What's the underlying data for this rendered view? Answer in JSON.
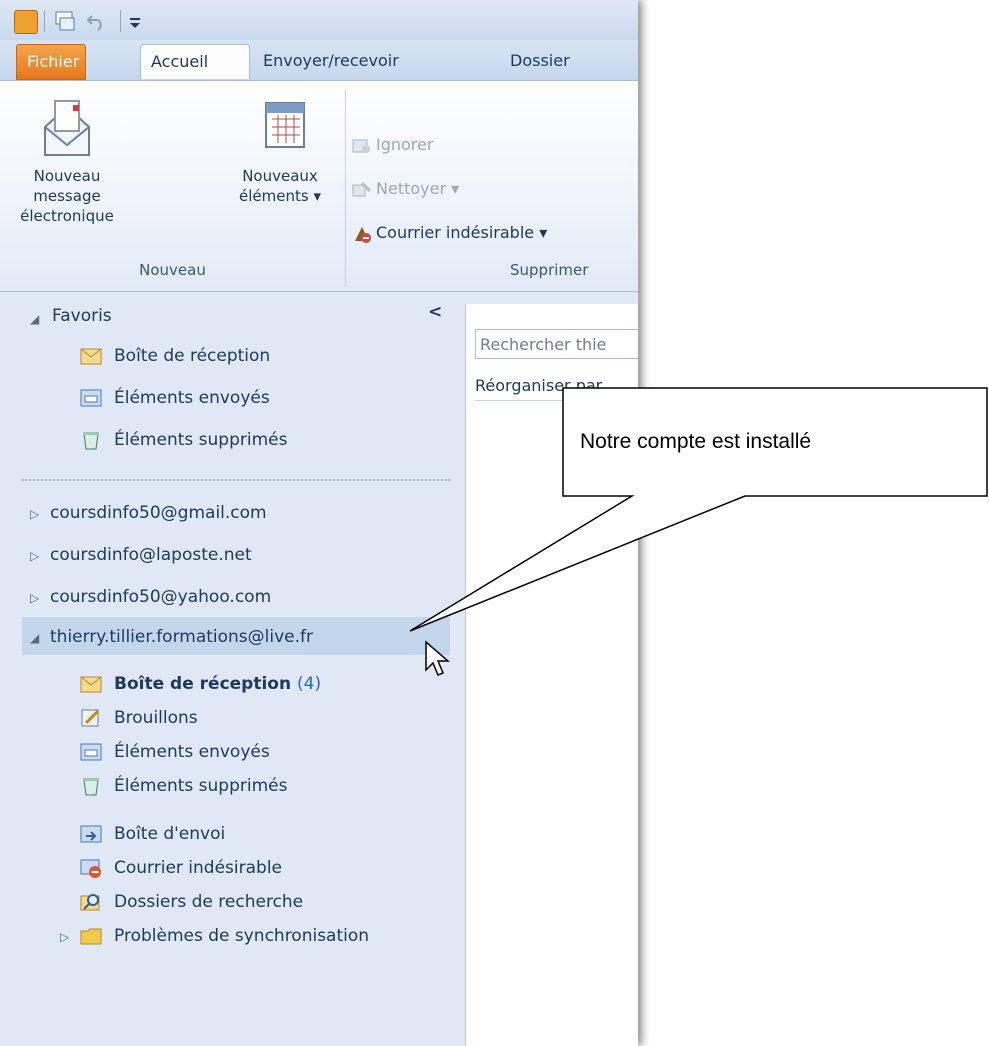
{
  "ribbon_tabs": [
    "Fichier",
    "Accueil",
    "Envoyer/recevoir",
    "Dossier"
  ],
  "ribbon": {
    "new_message": [
      "Nouveau message",
      "électronique"
    ],
    "new_items": [
      "Nouveaux",
      "éléments ▾"
    ],
    "group_nouveau": "Nouveau",
    "ignore": "Ignorer",
    "clean": "Nettoyer ▾",
    "junk": "Courrier indésirable ▾",
    "group_supprimer": "Supprimer"
  },
  "nav": {
    "collapse_glyph": "<",
    "favorites_header": "Favoris",
    "favorites": [
      "Boîte de réception",
      "Éléments envoyés",
      "Éléments supprimés"
    ],
    "accounts": [
      "coursdinfo50@gmail.com",
      "coursdinfo@laposte.net",
      "coursdinfo50@yahoo.com"
    ],
    "selected_account": "thierry.tillier.formations@live.fr",
    "folders": {
      "inbox": "Boîte de réception",
      "inbox_count": "(4)",
      "drafts": "Brouillons",
      "sent": "Éléments envoyés",
      "deleted": "Éléments supprimés",
      "outbox": "Boîte d'envoi",
      "junk": "Courrier indésirable",
      "search": "Dossiers de recherche",
      "sync": "Problèmes de synchronisation"
    }
  },
  "mail_list": {
    "search_placeholder": "Rechercher thie",
    "arrange_by": "Réorganiser par"
  },
  "callout": {
    "text": "Notre compte est installé"
  }
}
